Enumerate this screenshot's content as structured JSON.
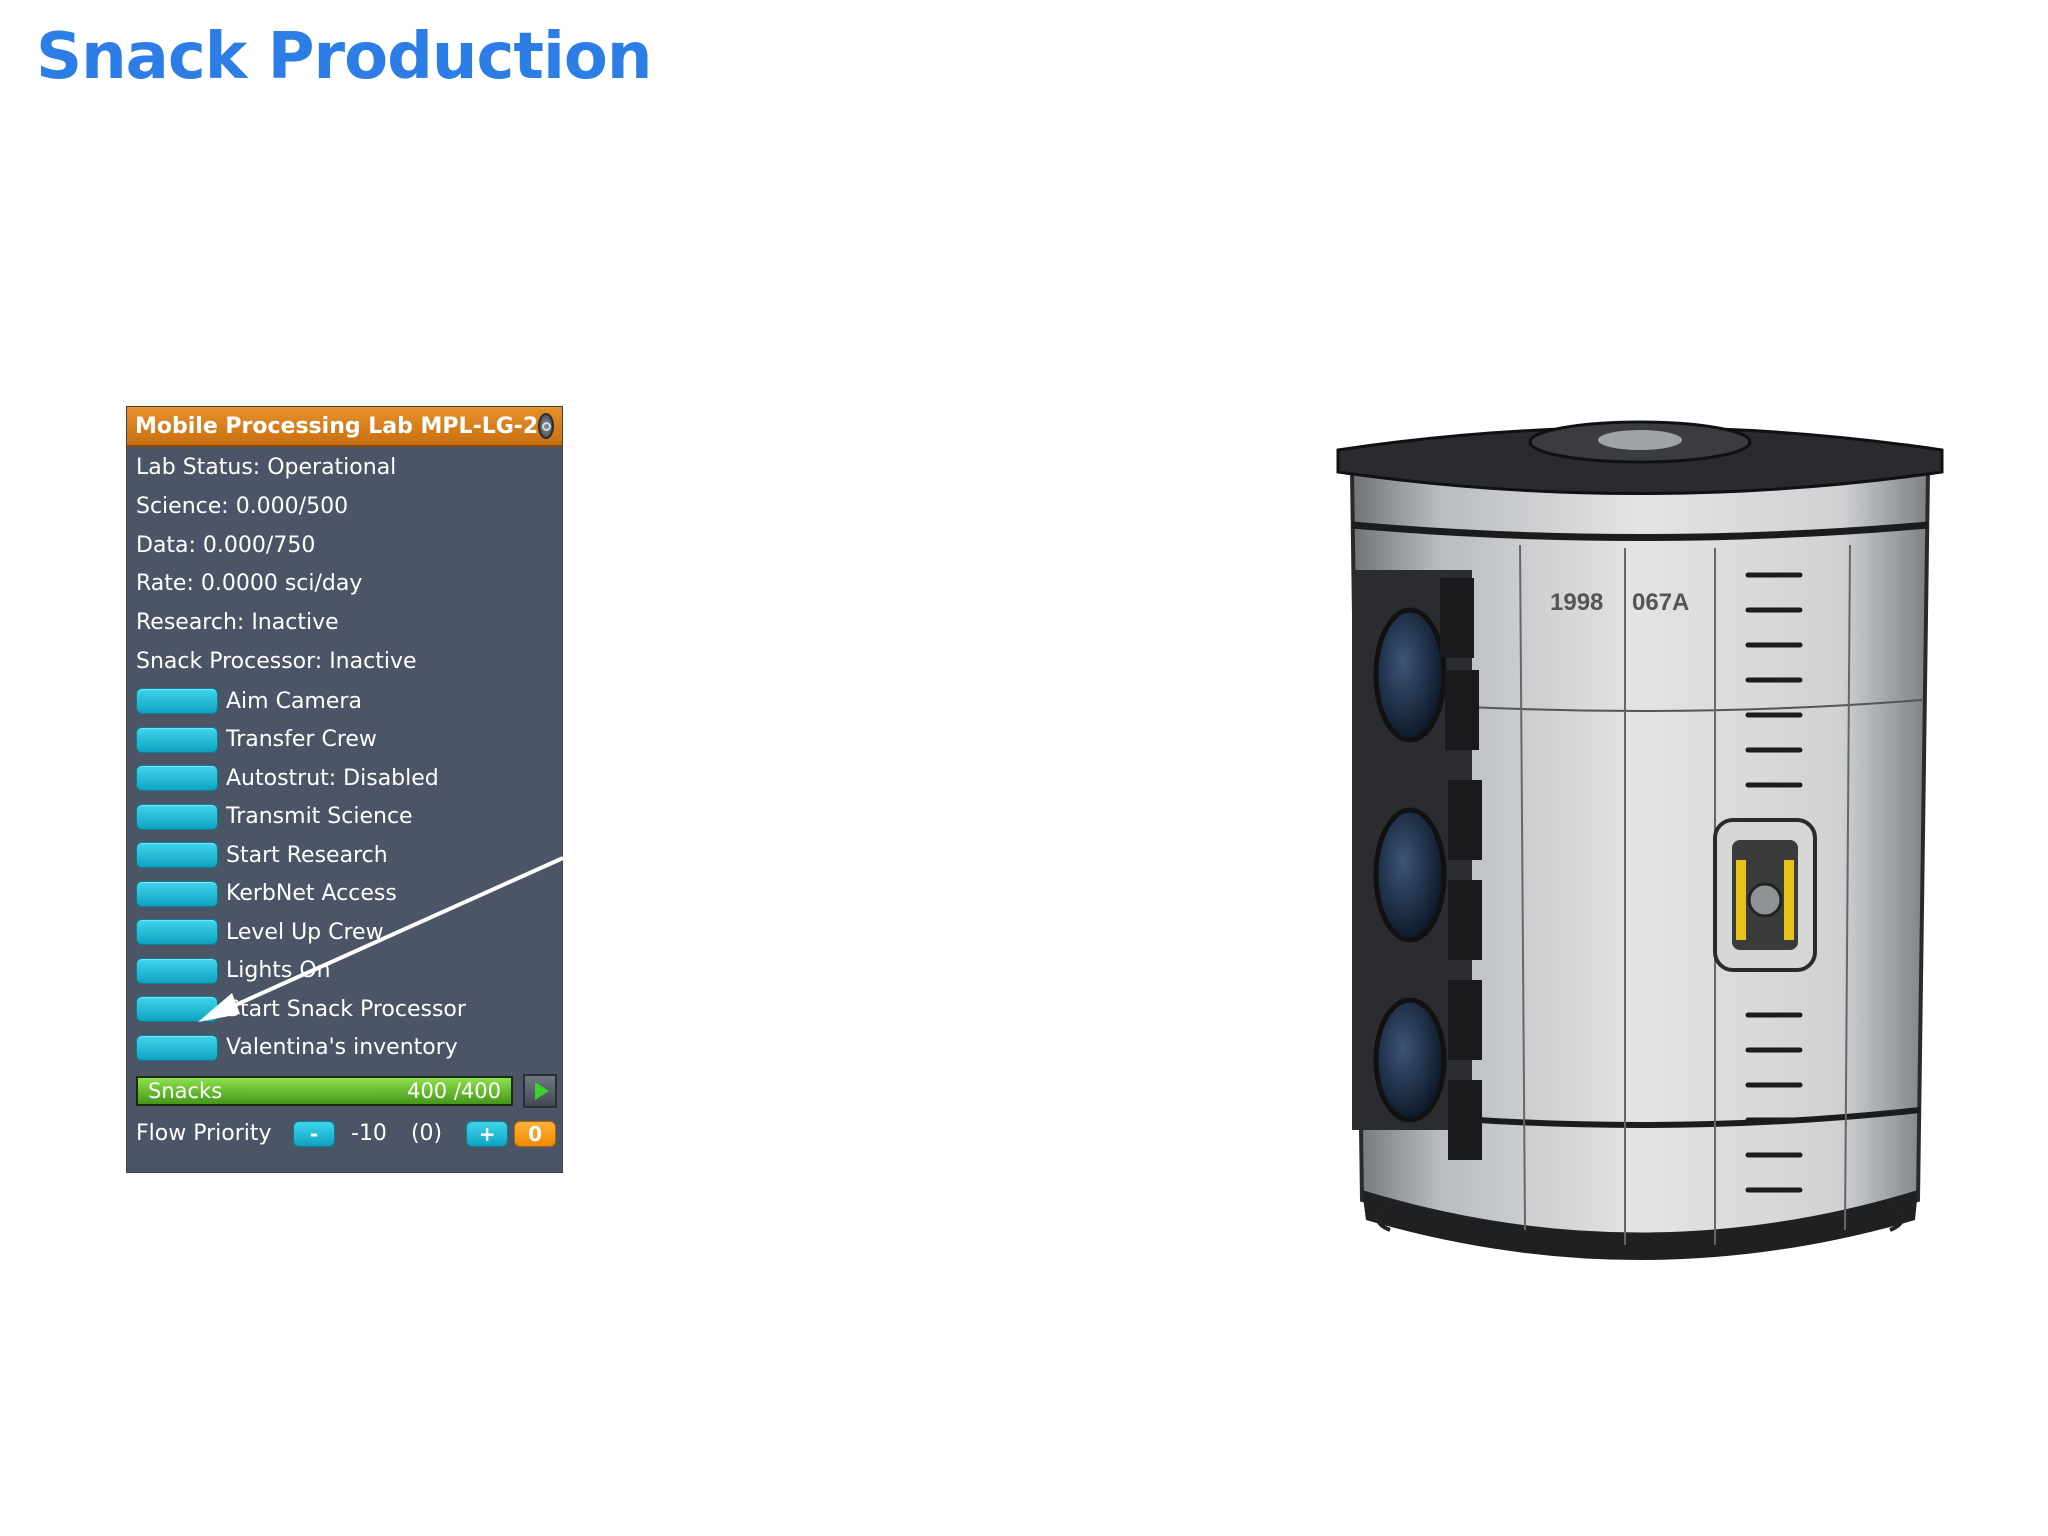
{
  "page": {
    "title": "Snack Production"
  },
  "window": {
    "title": "Mobile Processing Lab MPL-LG-2",
    "close_icon": "close-icon",
    "status_lines": [
      "Lab Status: Operational",
      "Science: 0.000/500",
      "Data: 0.000/750",
      "Rate: 0.0000 sci/day",
      "Research: Inactive",
      "Snack Processor: Inactive"
    ],
    "actions": [
      "Aim Camera",
      "Transfer Crew",
      "Autostrut: Disabled",
      "Transmit Science",
      "Start Research",
      "KerbNet Access",
      "Level Up Crew",
      "Lights On",
      "Start Snack Processor",
      "Valentina's inventory"
    ],
    "resource": {
      "name": "Snacks",
      "amount": "400 /400",
      "fill_fraction": 1.0
    },
    "flow": {
      "label": "Flow Priority",
      "minus": "-",
      "value": "-10",
      "default": "(0)",
      "plus": "+",
      "reset": "0"
    }
  },
  "colors": {
    "title": "#2d7de6",
    "header": "#e08420",
    "panel": "#4c5566",
    "button": "#1bbad8",
    "resource_bar": "#5fb52a",
    "arrow": "#ffffff"
  },
  "annotation": {
    "type": "arrow",
    "points_to": "Start Snack Processor"
  }
}
